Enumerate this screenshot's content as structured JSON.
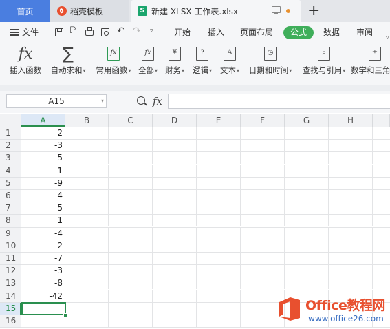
{
  "tabs": {
    "home": "首页",
    "daoke": "稻壳模板",
    "doc": "新建 XLSX 工作表.xlsx",
    "doc_icon": "S",
    "add": "+"
  },
  "menubar": {
    "file": "文件",
    "kaishi": "开始",
    "charu": "插入",
    "buju": "页面布局",
    "gongshi": "公式",
    "shuju": "数据",
    "shenyue": "审阅",
    "undo": "↶",
    "redo": "↷",
    "export": "ℙ",
    "more": "▿",
    "active_color": "#3fae5a"
  },
  "ribbon": {
    "insert_func": "插入函数",
    "autosum": "自动求和",
    "common": "常用函数",
    "all": "全部",
    "finance": "财务",
    "logic": "逻辑",
    "text": "文本",
    "datetime": "日期和时间",
    "lookup": "查找与引用",
    "math": "数学和三角",
    "caret": "▾",
    "icon_fx": "fx",
    "icon_sigma": "∑",
    "icon_yen": "¥",
    "icon_q": "?",
    "icon_a": "A",
    "icon_clock": "◷",
    "icon_search": "⌕",
    "icon_plus": "±"
  },
  "formula_bar": {
    "name_box": "A15",
    "fx": "fx",
    "value": ""
  },
  "columns": [
    "A",
    "B",
    "C",
    "D",
    "E",
    "F",
    "G",
    "H"
  ],
  "rows": [
    {
      "n": "1",
      "a": "2"
    },
    {
      "n": "2",
      "a": "-3"
    },
    {
      "n": "3",
      "a": "-5"
    },
    {
      "n": "4",
      "a": "-1"
    },
    {
      "n": "5",
      "a": "-9"
    },
    {
      "n": "6",
      "a": "4"
    },
    {
      "n": "7",
      "a": "5"
    },
    {
      "n": "8",
      "a": "1"
    },
    {
      "n": "9",
      "a": "-4"
    },
    {
      "n": "10",
      "a": "-2"
    },
    {
      "n": "11",
      "a": "-7"
    },
    {
      "n": "12",
      "a": "-3"
    },
    {
      "n": "13",
      "a": "-8"
    },
    {
      "n": "14",
      "a": "-42"
    },
    {
      "n": "15",
      "a": ""
    },
    {
      "n": "16",
      "a": ""
    }
  ],
  "watermark": {
    "brand": "Office教程网",
    "url": "www.office26.com"
  }
}
